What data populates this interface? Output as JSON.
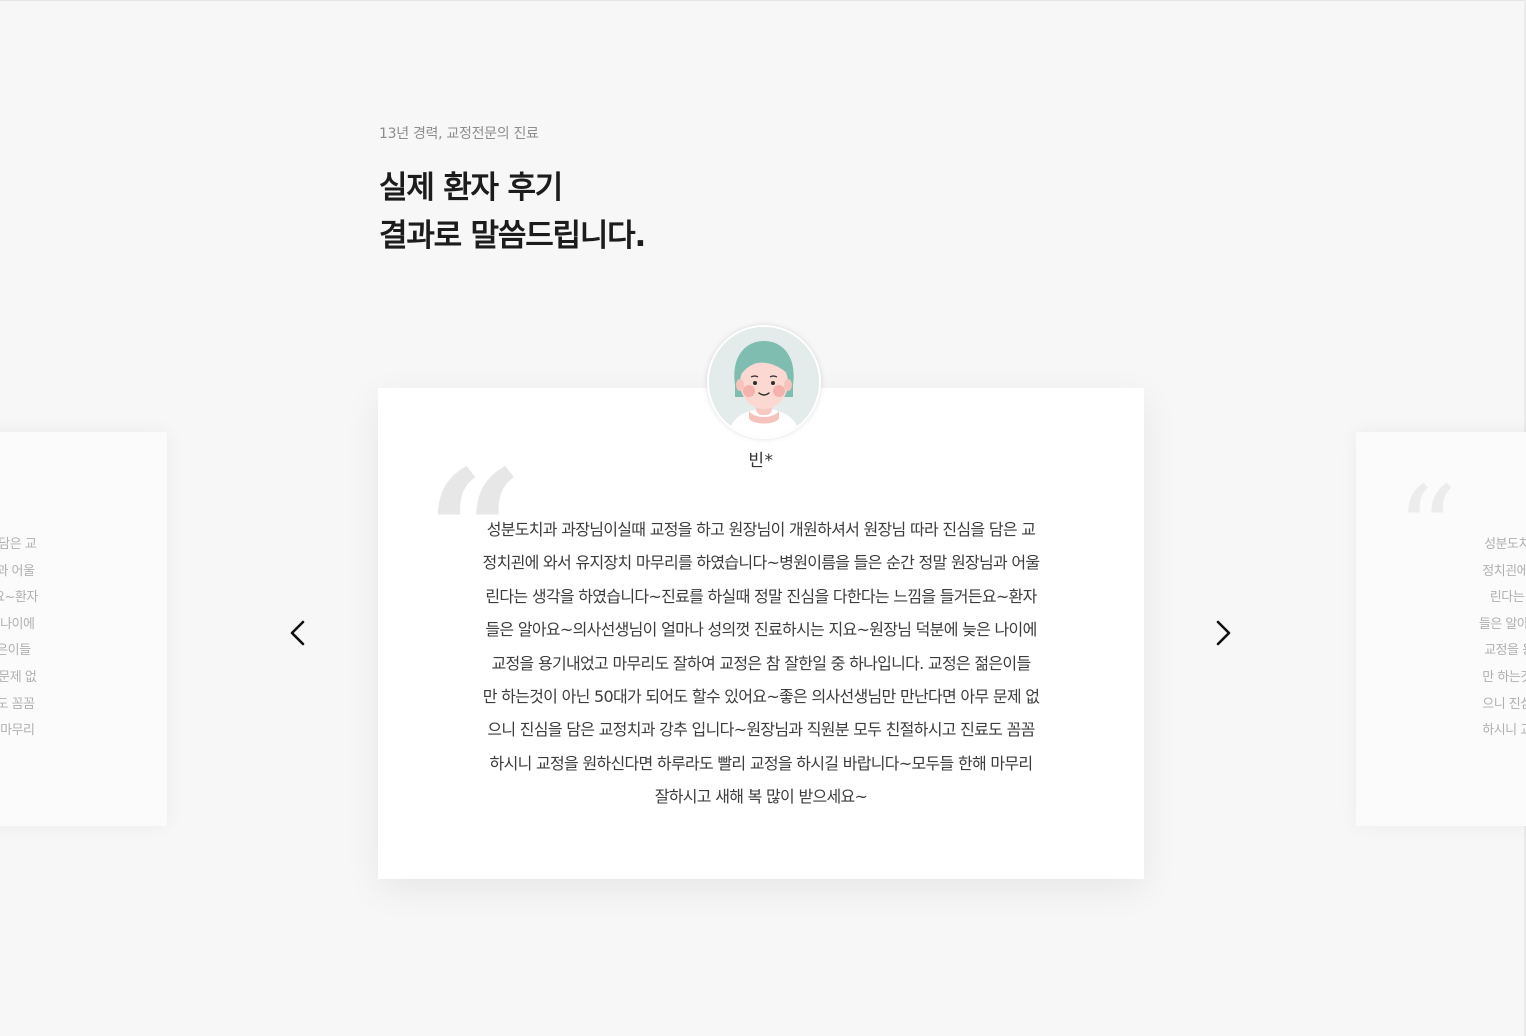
{
  "section": {
    "eyebrow": "13년 경력, 교정전문의 진료",
    "headline_lines": [
      "실제 환자 후기",
      "결과로 말씀드립니다."
    ]
  },
  "active_review": {
    "name": "빈*",
    "avatar_icon": "patient-avatar-icon",
    "quote_icon": "quote-mark-icon",
    "lines": [
      "성분도치과 과장님이실때 교정을 하고 원장님이 개원하셔서 원장님 따라 진심을 담은 교",
      "정치괸에 와서 유지장치 마무리를 하였습니다~병원이름을 들은 순간 정말 원장님과 어울",
      "린다는 생각을 하였습니다~진료를 하실때 정말 진심을 다한다는 느낌을 들거든요~환자",
      "들은 알아요~의사선생님이 얼마나 성의껏 진료하시는 지요~원장님 덕분에 늦은 나이에",
      "교정을 용기내었고 마무리도 잘하여 교정은 참 잘한일 중 하나입니다. 교정은 젊은이들",
      "만 하는것이 아닌 50대가 되어도 할수 있어요~좋은 의사선생님만 만난다면 아무 문제 없",
      "으니 진심을 담은 교정치과 강추 입니다~원장님과 직원분 모두 친절하시고 진료도 꼼꼼",
      "하시니 교정을 원하신다면 하루라도 빨리 교정을 하시길 바랍니다~모두들 한해 마무리",
      "잘하시고 새해 복 많이 받으세요~"
    ]
  },
  "side_reviews": {
    "left_lines": [
      "따라 진심을 담은 교",
      "정말 원장님과 어울",
      "심을 들거든요~환자",
      "덕분에 늦은 나이에",
      ". 교정은 젊은이들",
      "난다면 아무 문제 없",
      "하시고 진료도 꼼꼼",
      "모두들 한해 마무리"
    ],
    "right_lines": [
      "성분도치과 과장",
      "정치괸에 와서 유",
      "린다는 생각을 ",
      "들은 알아요~의시",
      "교정을 용기내었",
      "만 하는것이 아닌",
      "으니 진심을 담은",
      "하시니 교정을 원"
    ]
  },
  "controls": {
    "prev_icon": "chevron-left-icon",
    "next_icon": "chevron-right-icon"
  },
  "colors": {
    "background": "#f7f7f7",
    "card": "#ffffff",
    "avatar_hair": "#7fbdb1",
    "avatar_bg": "#e3ecea"
  }
}
